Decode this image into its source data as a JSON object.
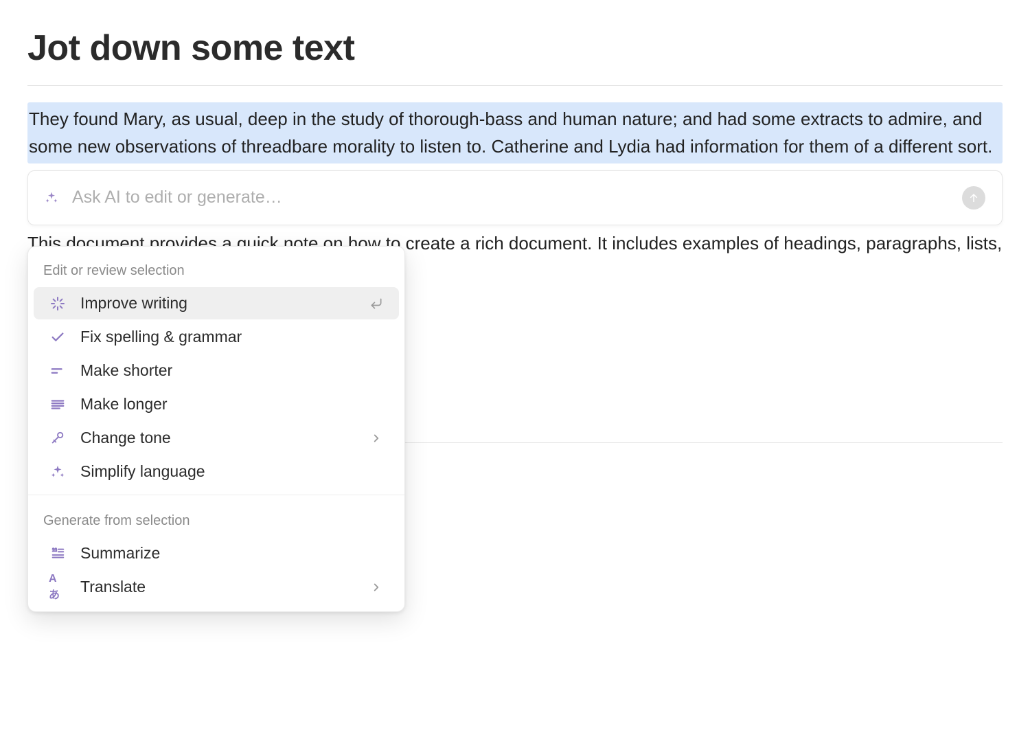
{
  "document": {
    "title": "Jot down some text",
    "selection": "They found Mary, as usual, deep in the study of thorough-bass and human nature; and had some extracts to admire, and some new observations of threadbare morality to listen to. Catherine and Lydia had information for them of a different sort.",
    "below_paragraph": "This document provides a quick note on how to create a rich document. It includes examples of headings, paragraphs, lists, and links."
  },
  "ai_bar": {
    "placeholder": "Ask AI to edit or generate…"
  },
  "menu": {
    "section1_label": "Edit or review selection",
    "items1": [
      {
        "label": "Improve writing",
        "icon": "magic-wand-icon",
        "selected": true,
        "trail": "enter"
      },
      {
        "label": "Fix spelling & grammar",
        "icon": "check-icon",
        "selected": false,
        "trail": ""
      },
      {
        "label": "Make shorter",
        "icon": "short-lines-icon",
        "selected": false,
        "trail": ""
      },
      {
        "label": "Make longer",
        "icon": "long-lines-icon",
        "selected": false,
        "trail": ""
      },
      {
        "label": "Change tone",
        "icon": "mic-icon",
        "selected": false,
        "trail": "chevron"
      },
      {
        "label": "Simplify language",
        "icon": "sparkle-icon",
        "selected": false,
        "trail": ""
      }
    ],
    "section2_label": "Generate from selection",
    "items2": [
      {
        "label": "Summarize",
        "icon": "quote-list-icon",
        "selected": false,
        "trail": ""
      },
      {
        "label": "Translate",
        "icon": "translate-icon",
        "selected": false,
        "trail": "chevron"
      }
    ]
  },
  "colors": {
    "accent": "#8d79c2",
    "selection_bg": "#d8e7fb"
  }
}
